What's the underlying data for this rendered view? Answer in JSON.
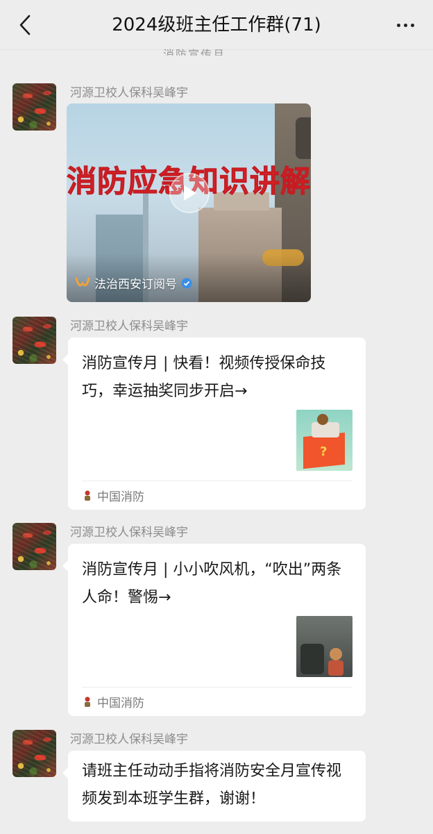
{
  "header": {
    "back_icon": "chevron-left-icon",
    "title": "2024级班主任工作群(71)",
    "more_icon": "ellipsis-icon"
  },
  "partial_text": "消防宣传月",
  "messages": [
    {
      "sender": "河源卫校人保科吴峰宇",
      "type": "video",
      "video_title": "消防应急知识讲解",
      "source": "法治西安订阅号",
      "verified": true
    },
    {
      "sender": "河源卫校人保科吴峰宇",
      "type": "link",
      "title": "消防宣传月 | 快看！视频传授保命技巧，幸运抽奖同步开启→",
      "source": "中国消防"
    },
    {
      "sender": "河源卫校人保科吴峰宇",
      "type": "link",
      "title": "消防宣传月 | 小小吹风机，“吹出”两条人命！警惕→",
      "source": "中国消防"
    },
    {
      "sender": "河源卫校人保科吴峰宇",
      "type": "text",
      "text": "请班主任动动手指将消防安全月宣传视频发到本班学生群，谢谢！"
    }
  ],
  "colors": {
    "background": "#ededed",
    "bubble": "#ffffff",
    "sender_name": "#8c8c8c",
    "video_title": "#e4232a"
  }
}
